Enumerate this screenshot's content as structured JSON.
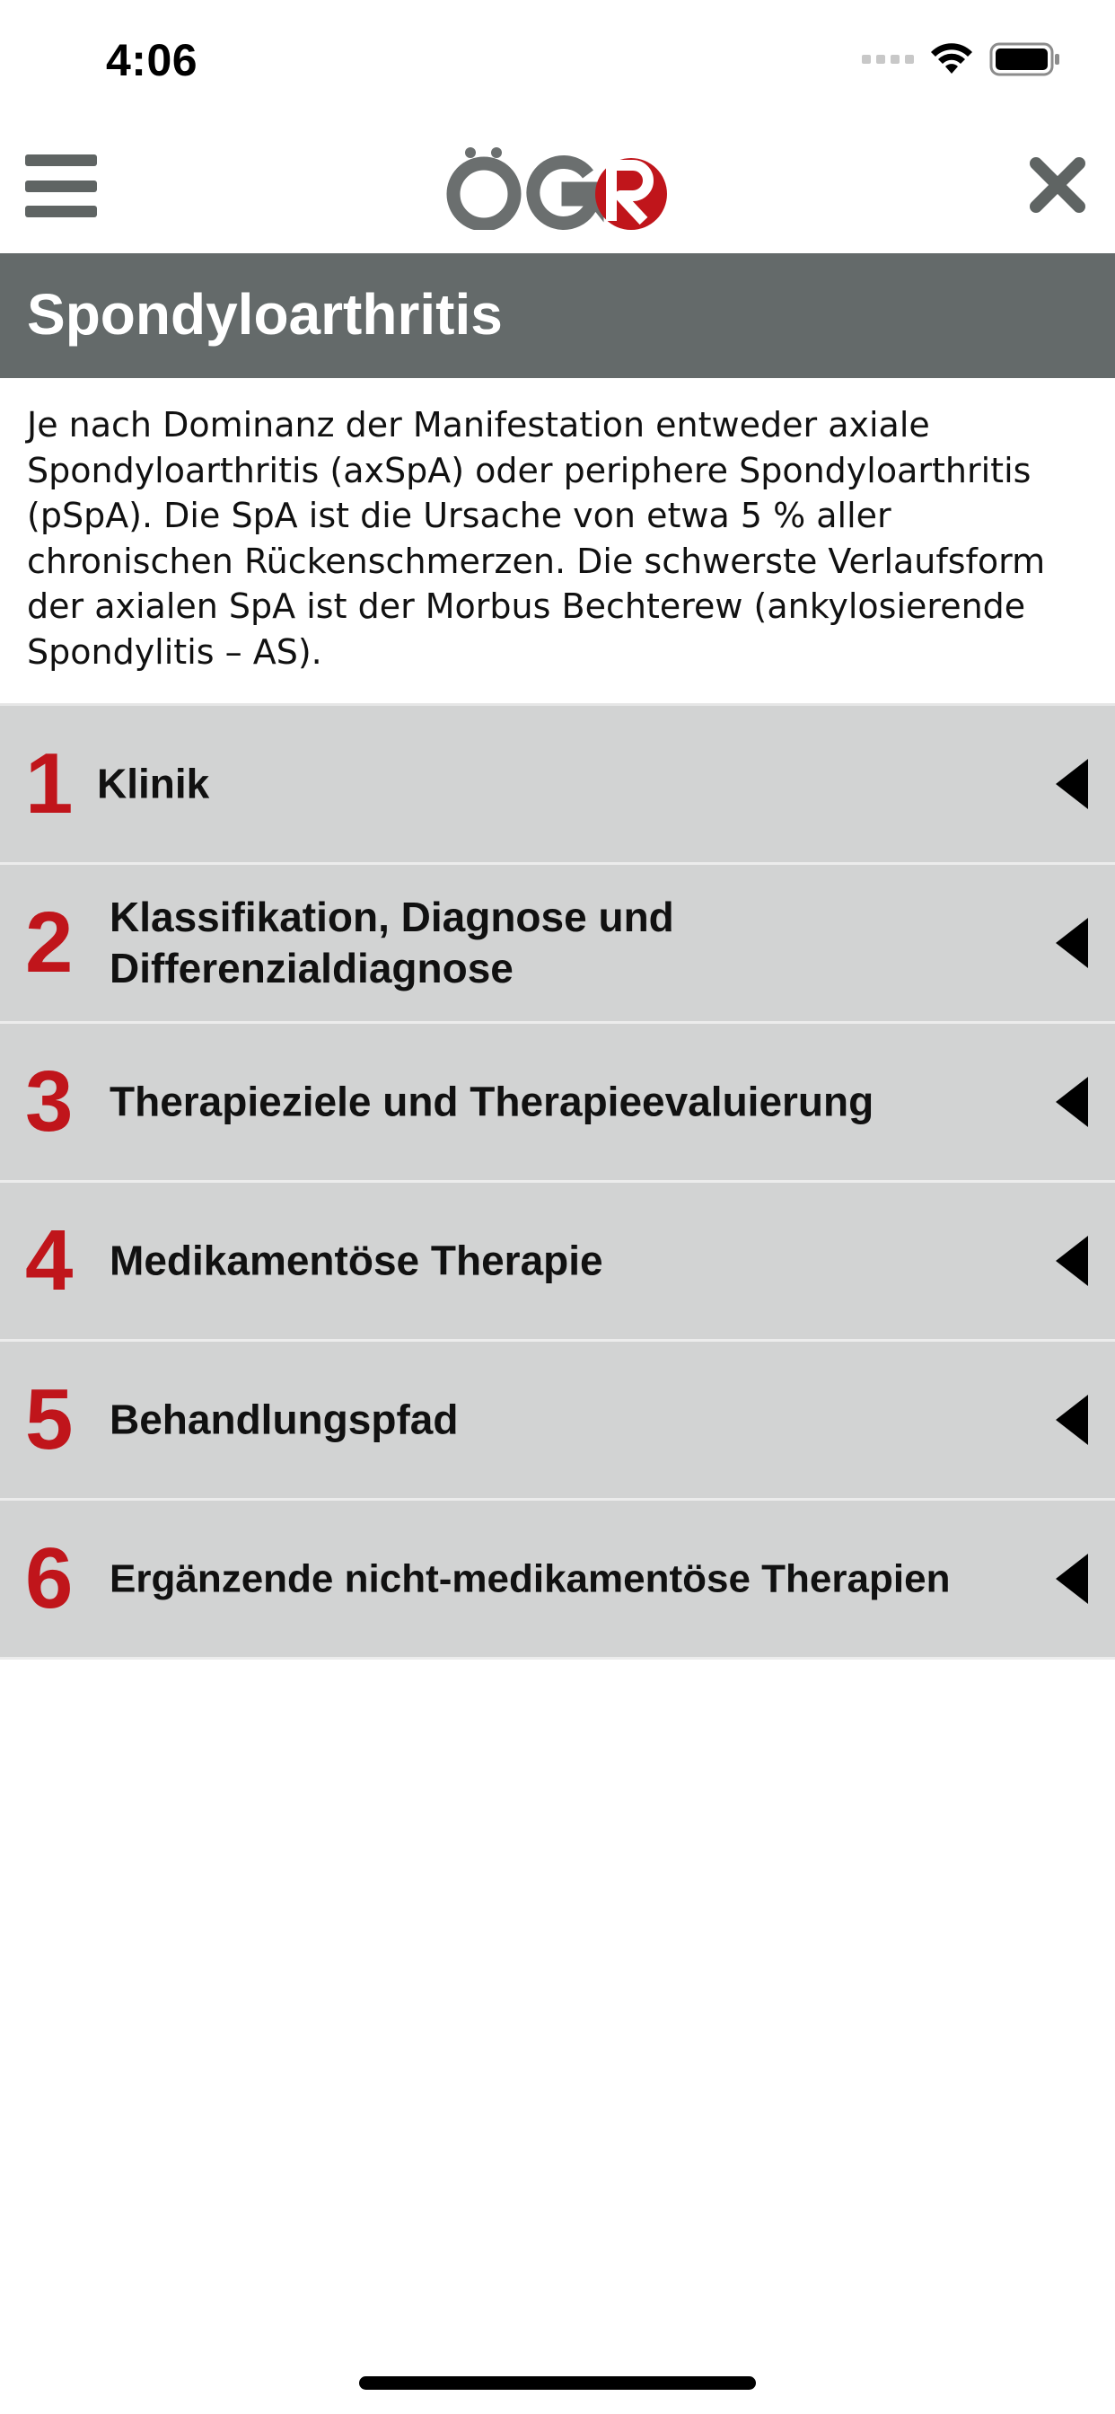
{
  "status_bar": {
    "time": "4:06",
    "signal_icon": "cellular-signal-icon",
    "wifi_icon": "wifi-icon",
    "battery_icon": "battery-icon"
  },
  "navbar": {
    "menu_icon": "hamburger-menu-icon",
    "logo_text": "ÖGR",
    "close_icon": "close-icon"
  },
  "page": {
    "title": "Spondyloarthritis",
    "intro_lines": [
      "Je nach Dominanz der Manifestation entweder axiale",
      "Spondyloarthritis (axSpA) oder periphere Spondyloarthritis",
      "(pSpA). Die SpA ist die Ursache von etwa 5 % aller",
      "chronischen Rückenschmerzen. Die schwerste Verlaufsform",
      "der axialen SpA ist der Morbus Bechterew (ankylosierende",
      "Spondylitis – AS)."
    ]
  },
  "sections": [
    {
      "number": "1",
      "label": "Klinik"
    },
    {
      "number": "2",
      "label": "Klassifikation, Diagnose und Differenzialdiagnose"
    },
    {
      "number": "3",
      "label": "Therapieziele und Therapieevaluierung"
    },
    {
      "number": "4",
      "label": "Medikamentöse Therapie"
    },
    {
      "number": "5",
      "label": "Behandlungspfad"
    },
    {
      "number": "6",
      "label": "Ergänzende nicht-medikamentöse Therapien"
    }
  ],
  "colors": {
    "accent_red": "#c0151b",
    "header_gray": "#646a6a",
    "row_gray": "#d2d3d3",
    "logo_gray": "#6b6f6f"
  }
}
